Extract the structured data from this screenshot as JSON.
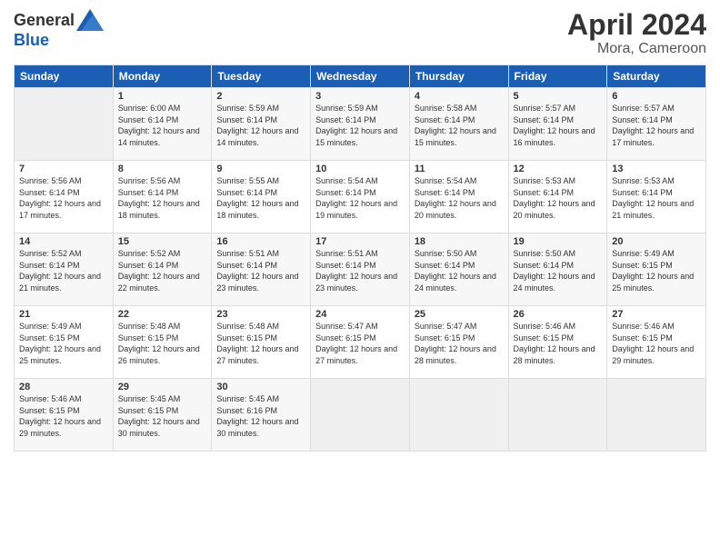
{
  "header": {
    "logo_general": "General",
    "logo_blue": "Blue",
    "title": "April 2024",
    "subtitle": "Mora, Cameroon"
  },
  "weekdays": [
    "Sunday",
    "Monday",
    "Tuesday",
    "Wednesday",
    "Thursday",
    "Friday",
    "Saturday"
  ],
  "weeks": [
    [
      {
        "day": "",
        "info": ""
      },
      {
        "day": "1",
        "info": "Sunrise: 6:00 AM\nSunset: 6:14 PM\nDaylight: 12 hours\nand 14 minutes."
      },
      {
        "day": "2",
        "info": "Sunrise: 5:59 AM\nSunset: 6:14 PM\nDaylight: 12 hours\nand 14 minutes."
      },
      {
        "day": "3",
        "info": "Sunrise: 5:59 AM\nSunset: 6:14 PM\nDaylight: 12 hours\nand 15 minutes."
      },
      {
        "day": "4",
        "info": "Sunrise: 5:58 AM\nSunset: 6:14 PM\nDaylight: 12 hours\nand 15 minutes."
      },
      {
        "day": "5",
        "info": "Sunrise: 5:57 AM\nSunset: 6:14 PM\nDaylight: 12 hours\nand 16 minutes."
      },
      {
        "day": "6",
        "info": "Sunrise: 5:57 AM\nSunset: 6:14 PM\nDaylight: 12 hours\nand 17 minutes."
      }
    ],
    [
      {
        "day": "7",
        "info": "Sunrise: 5:56 AM\nSunset: 6:14 PM\nDaylight: 12 hours\nand 17 minutes."
      },
      {
        "day": "8",
        "info": "Sunrise: 5:56 AM\nSunset: 6:14 PM\nDaylight: 12 hours\nand 18 minutes."
      },
      {
        "day": "9",
        "info": "Sunrise: 5:55 AM\nSunset: 6:14 PM\nDaylight: 12 hours\nand 18 minutes."
      },
      {
        "day": "10",
        "info": "Sunrise: 5:54 AM\nSunset: 6:14 PM\nDaylight: 12 hours\nand 19 minutes."
      },
      {
        "day": "11",
        "info": "Sunrise: 5:54 AM\nSunset: 6:14 PM\nDaylight: 12 hours\nand 20 minutes."
      },
      {
        "day": "12",
        "info": "Sunrise: 5:53 AM\nSunset: 6:14 PM\nDaylight: 12 hours\nand 20 minutes."
      },
      {
        "day": "13",
        "info": "Sunrise: 5:53 AM\nSunset: 6:14 PM\nDaylight: 12 hours\nand 21 minutes."
      }
    ],
    [
      {
        "day": "14",
        "info": "Sunrise: 5:52 AM\nSunset: 6:14 PM\nDaylight: 12 hours\nand 21 minutes."
      },
      {
        "day": "15",
        "info": "Sunrise: 5:52 AM\nSunset: 6:14 PM\nDaylight: 12 hours\nand 22 minutes."
      },
      {
        "day": "16",
        "info": "Sunrise: 5:51 AM\nSunset: 6:14 PM\nDaylight: 12 hours\nand 23 minutes."
      },
      {
        "day": "17",
        "info": "Sunrise: 5:51 AM\nSunset: 6:14 PM\nDaylight: 12 hours\nand 23 minutes."
      },
      {
        "day": "18",
        "info": "Sunrise: 5:50 AM\nSunset: 6:14 PM\nDaylight: 12 hours\nand 24 minutes."
      },
      {
        "day": "19",
        "info": "Sunrise: 5:50 AM\nSunset: 6:14 PM\nDaylight: 12 hours\nand 24 minutes."
      },
      {
        "day": "20",
        "info": "Sunrise: 5:49 AM\nSunset: 6:15 PM\nDaylight: 12 hours\nand 25 minutes."
      }
    ],
    [
      {
        "day": "21",
        "info": "Sunrise: 5:49 AM\nSunset: 6:15 PM\nDaylight: 12 hours\nand 25 minutes."
      },
      {
        "day": "22",
        "info": "Sunrise: 5:48 AM\nSunset: 6:15 PM\nDaylight: 12 hours\nand 26 minutes."
      },
      {
        "day": "23",
        "info": "Sunrise: 5:48 AM\nSunset: 6:15 PM\nDaylight: 12 hours\nand 27 minutes."
      },
      {
        "day": "24",
        "info": "Sunrise: 5:47 AM\nSunset: 6:15 PM\nDaylight: 12 hours\nand 27 minutes."
      },
      {
        "day": "25",
        "info": "Sunrise: 5:47 AM\nSunset: 6:15 PM\nDaylight: 12 hours\nand 28 minutes."
      },
      {
        "day": "26",
        "info": "Sunrise: 5:46 AM\nSunset: 6:15 PM\nDaylight: 12 hours\nand 28 minutes."
      },
      {
        "day": "27",
        "info": "Sunrise: 5:46 AM\nSunset: 6:15 PM\nDaylight: 12 hours\nand 29 minutes."
      }
    ],
    [
      {
        "day": "28",
        "info": "Sunrise: 5:46 AM\nSunset: 6:15 PM\nDaylight: 12 hours\nand 29 minutes."
      },
      {
        "day": "29",
        "info": "Sunrise: 5:45 AM\nSunset: 6:15 PM\nDaylight: 12 hours\nand 30 minutes."
      },
      {
        "day": "30",
        "info": "Sunrise: 5:45 AM\nSunset: 6:16 PM\nDaylight: 12 hours\nand 30 minutes."
      },
      {
        "day": "",
        "info": ""
      },
      {
        "day": "",
        "info": ""
      },
      {
        "day": "",
        "info": ""
      },
      {
        "day": "",
        "info": ""
      }
    ]
  ]
}
